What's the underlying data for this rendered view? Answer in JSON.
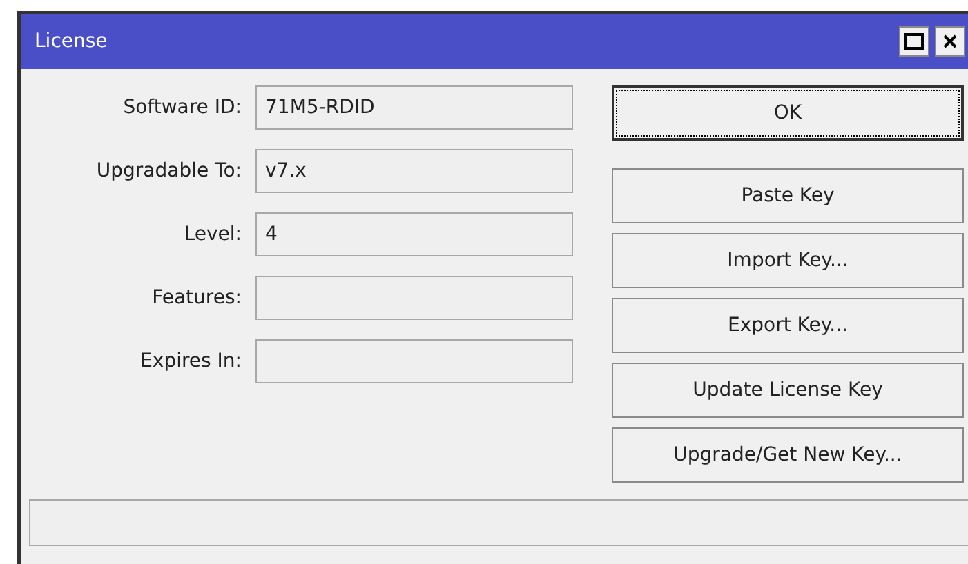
{
  "window": {
    "title": "License"
  },
  "fields": [
    {
      "label": "Software ID:",
      "value": "71M5-RDID"
    },
    {
      "label": "Upgradable To:",
      "value": "v7.x"
    },
    {
      "label": "Level:",
      "value": "4"
    },
    {
      "label": "Features:"
    },
    {
      "label": "Expires In:"
    }
  ],
  "buttons": [
    {
      "label": "OK",
      "focused": true
    },
    {
      "label": "Paste Key",
      "focused": false
    },
    {
      "label": "Import Key...",
      "focused": false
    },
    {
      "label": "Export Key...",
      "focused": false
    },
    {
      "label": "Update License Key",
      "focused": false
    },
    {
      "label": "Upgrade/Get New Key...",
      "focused": false
    }
  ]
}
